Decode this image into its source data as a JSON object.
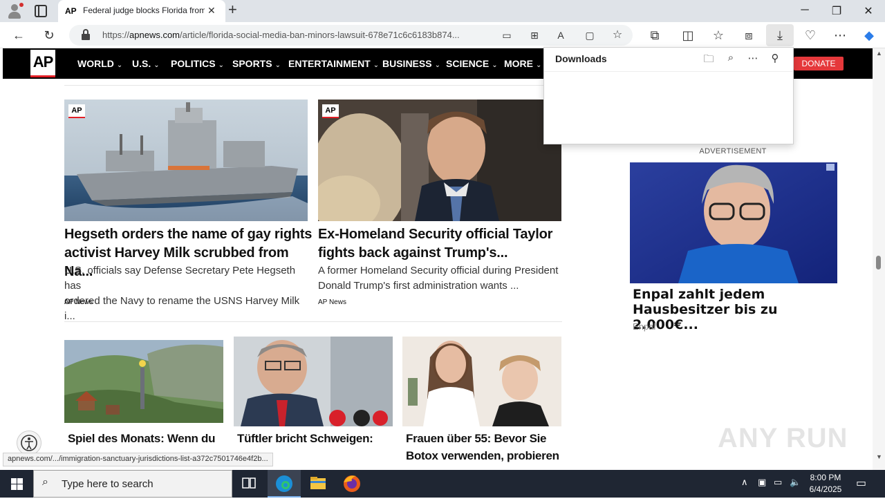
{
  "browser": {
    "tab_title": "Federal judge blocks Florida from",
    "tab_favicon": "AP",
    "url_prefix": "https://",
    "url_domain": "apnews.com",
    "url_path": "/article/florida-social-media-ban-minors-lawsuit-678e71c6c6183b874..."
  },
  "nav": {
    "logo": "AP",
    "items": [
      "WORLD",
      "U.S.",
      "POLITICS",
      "SPORTS",
      "ENTERTAINMENT",
      "BUSINESS",
      "SCIENCE",
      "MORE"
    ],
    "donate": "DONATE"
  },
  "downloads": {
    "title": "Downloads"
  },
  "articles": [
    {
      "badge": "AP",
      "headline_1": "Hegseth orders the name of gay rights",
      "headline_2": "activist Harvey Milk scrubbed from Na...",
      "summary_1": "U.S. officials say Defense Secretary Pete Hegseth has",
      "summary_2": "ordered the Navy to rename the USNS Harvey Milk i...",
      "source": "AP News"
    },
    {
      "badge": "AP",
      "headline_1": "Ex-Homeland Security official Taylor",
      "headline_2": "fights back against Trump's...",
      "summary_1": "A former Homeland Security official during President",
      "summary_2": "Donald Trump's first administration wants ...",
      "source": "AP News"
    }
  ],
  "small_articles": [
    {
      "line_1": "Spiel des Monats: Wenn du",
      "line_2": ""
    },
    {
      "line_1": "Tüftler bricht Schweigen:",
      "line_2": ""
    },
    {
      "line_1": "Frauen über 55: Bevor Sie",
      "line_2": "Botox verwenden, probieren"
    }
  ],
  "ad": {
    "label": "ADVERTISEMENT",
    "headline": "Enpal zahlt jedem Hausbesitzer bis zu 2.000€...",
    "source": "Enpal"
  },
  "status_url": "apnews.com/.../immigration-sanctuary-jurisdictions-list-a372c7501746e4f2b...",
  "watermark": "ANY RUN",
  "taskbar": {
    "search_placeholder": "Type here to search",
    "time": "8:00 PM",
    "date": "6/4/2025"
  }
}
